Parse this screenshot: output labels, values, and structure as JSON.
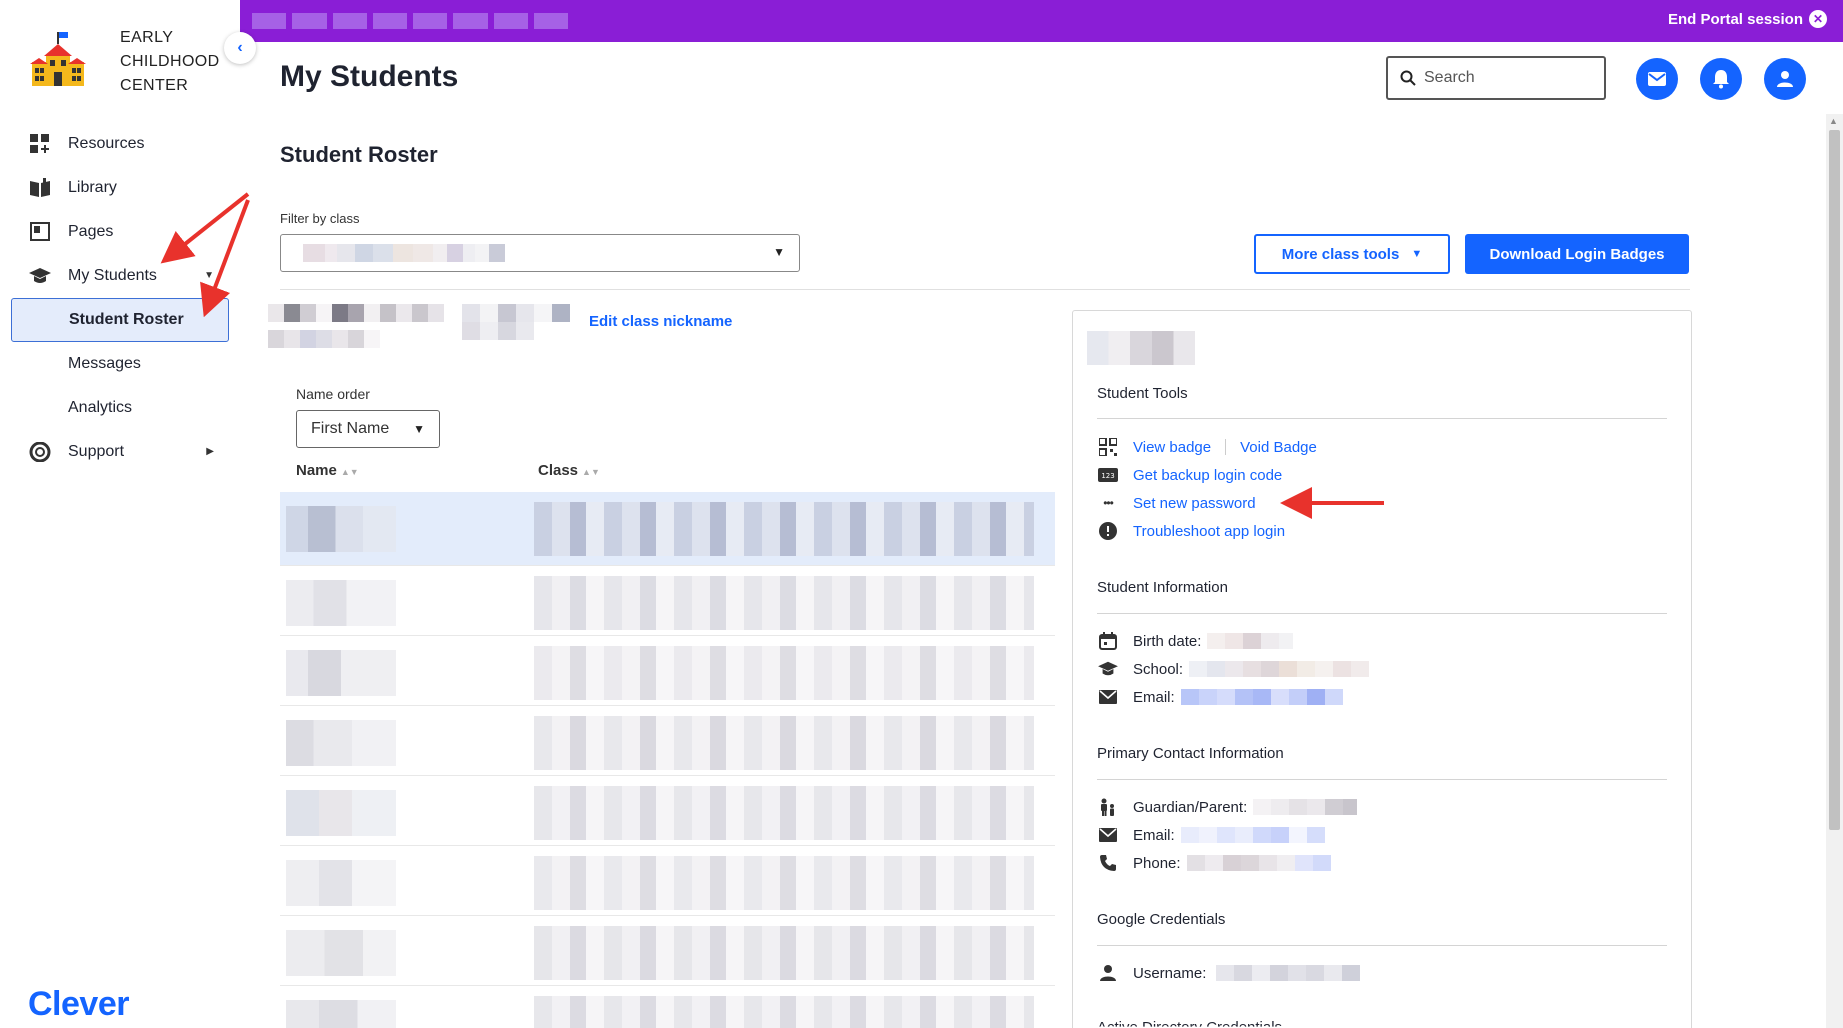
{
  "brand": {
    "line1": "EARLY",
    "line2": "CHILDHOOD",
    "line3": "CENTER",
    "logo_icon": "schoolhouse-icon"
  },
  "sidebar": {
    "collapse_icon": "chevron-left-icon",
    "items": [
      {
        "label": "Resources",
        "icon": "grid-plus-icon"
      },
      {
        "label": "Library",
        "icon": "book-icon"
      },
      {
        "label": "Pages",
        "icon": "page-icon"
      },
      {
        "label": "My Students",
        "icon": "graduation-cap-icon"
      },
      {
        "label": "Student Roster"
      },
      {
        "label": "Messages"
      },
      {
        "label": "Analytics"
      },
      {
        "label": "Support",
        "icon": "lifebuoy-icon"
      }
    ],
    "footer_logo": "Clever"
  },
  "topbar": {
    "end_session_label": "End Portal session",
    "color": "#8a1ed6"
  },
  "header": {
    "title": "My Students",
    "search_placeholder": "Search",
    "icons": [
      "mail-icon",
      "bell-icon",
      "user-icon"
    ]
  },
  "roster": {
    "section_title": "Student Roster",
    "filter_label": "Filter by class",
    "more_tools_label": "More class tools",
    "download_label": "Download Login Badges",
    "edit_nickname_label": "Edit class nickname",
    "name_order_label": "Name order",
    "name_order_value": "First Name",
    "columns": [
      "Name",
      "Class"
    ]
  },
  "panel": {
    "student_tools_title": "Student Tools",
    "tools": {
      "view_badge": "View badge",
      "void_badge": "Void Badge",
      "backup_code": "Get backup login code",
      "set_password": "Set new password",
      "troubleshoot": "Troubleshoot app login"
    },
    "student_info_title": "Student Information",
    "student_info": {
      "birth_date_label": "Birth date:",
      "school_label": "School:",
      "email_label": "Email:"
    },
    "primary_contact_title": "Primary Contact Information",
    "primary_contact": {
      "guardian_label": "Guardian/Parent:",
      "email_label": "Email:",
      "phone_label": "Phone:"
    },
    "google_title": "Google Credentials",
    "google": {
      "username_label": "Username:"
    },
    "ad_title": "Active Directory Credentials"
  },
  "colors": {
    "accent": "#1464ff",
    "danger": "#d41e1e",
    "annotation": "#e8322c",
    "selected_row": "#e3ecfb"
  }
}
